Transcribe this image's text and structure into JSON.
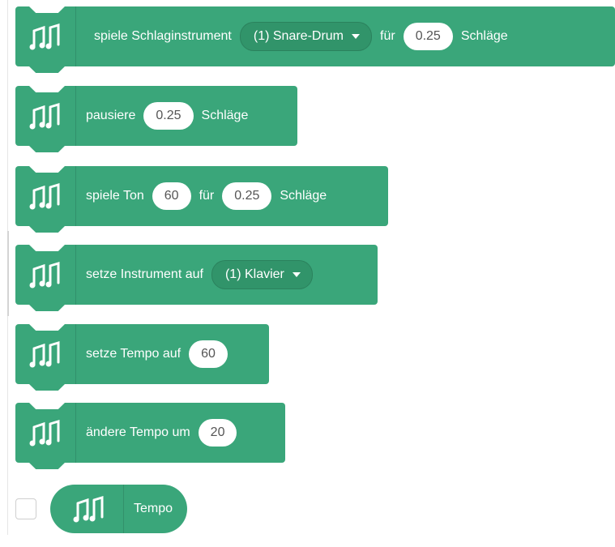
{
  "blocks": [
    {
      "parts": [
        {
          "type": "text",
          "text": "spiele Schlaginstrument"
        },
        {
          "type": "dropdown",
          "text": "(1) Snare-Drum"
        },
        {
          "type": "text",
          "text": "für"
        },
        {
          "type": "input",
          "text": "0.25"
        },
        {
          "type": "text",
          "text": "Schläge"
        }
      ]
    },
    {
      "parts": [
        {
          "type": "text",
          "text": "pausiere"
        },
        {
          "type": "input",
          "text": "0.25"
        },
        {
          "type": "text",
          "text": "Schläge"
        }
      ]
    },
    {
      "parts": [
        {
          "type": "text",
          "text": "spiele Ton"
        },
        {
          "type": "input",
          "text": "60"
        },
        {
          "type": "text",
          "text": "für"
        },
        {
          "type": "input",
          "text": "0.25"
        },
        {
          "type": "text",
          "text": "Schläge"
        }
      ]
    },
    {
      "parts": [
        {
          "type": "text",
          "text": "setze Instrument auf"
        },
        {
          "type": "dropdown",
          "text": "(1) Klavier"
        }
      ]
    },
    {
      "parts": [
        {
          "type": "text",
          "text": "setze Tempo auf"
        },
        {
          "type": "input",
          "text": "60"
        }
      ]
    },
    {
      "parts": [
        {
          "type": "text",
          "text": "ändere Tempo um"
        },
        {
          "type": "input",
          "text": "20"
        }
      ]
    }
  ],
  "reporter": {
    "label": "Tempo",
    "checked": false
  },
  "icon": "music-notes-icon",
  "colors": {
    "block": "#3aa67a",
    "dropdown": "#31946a",
    "input_text": "#555555"
  }
}
